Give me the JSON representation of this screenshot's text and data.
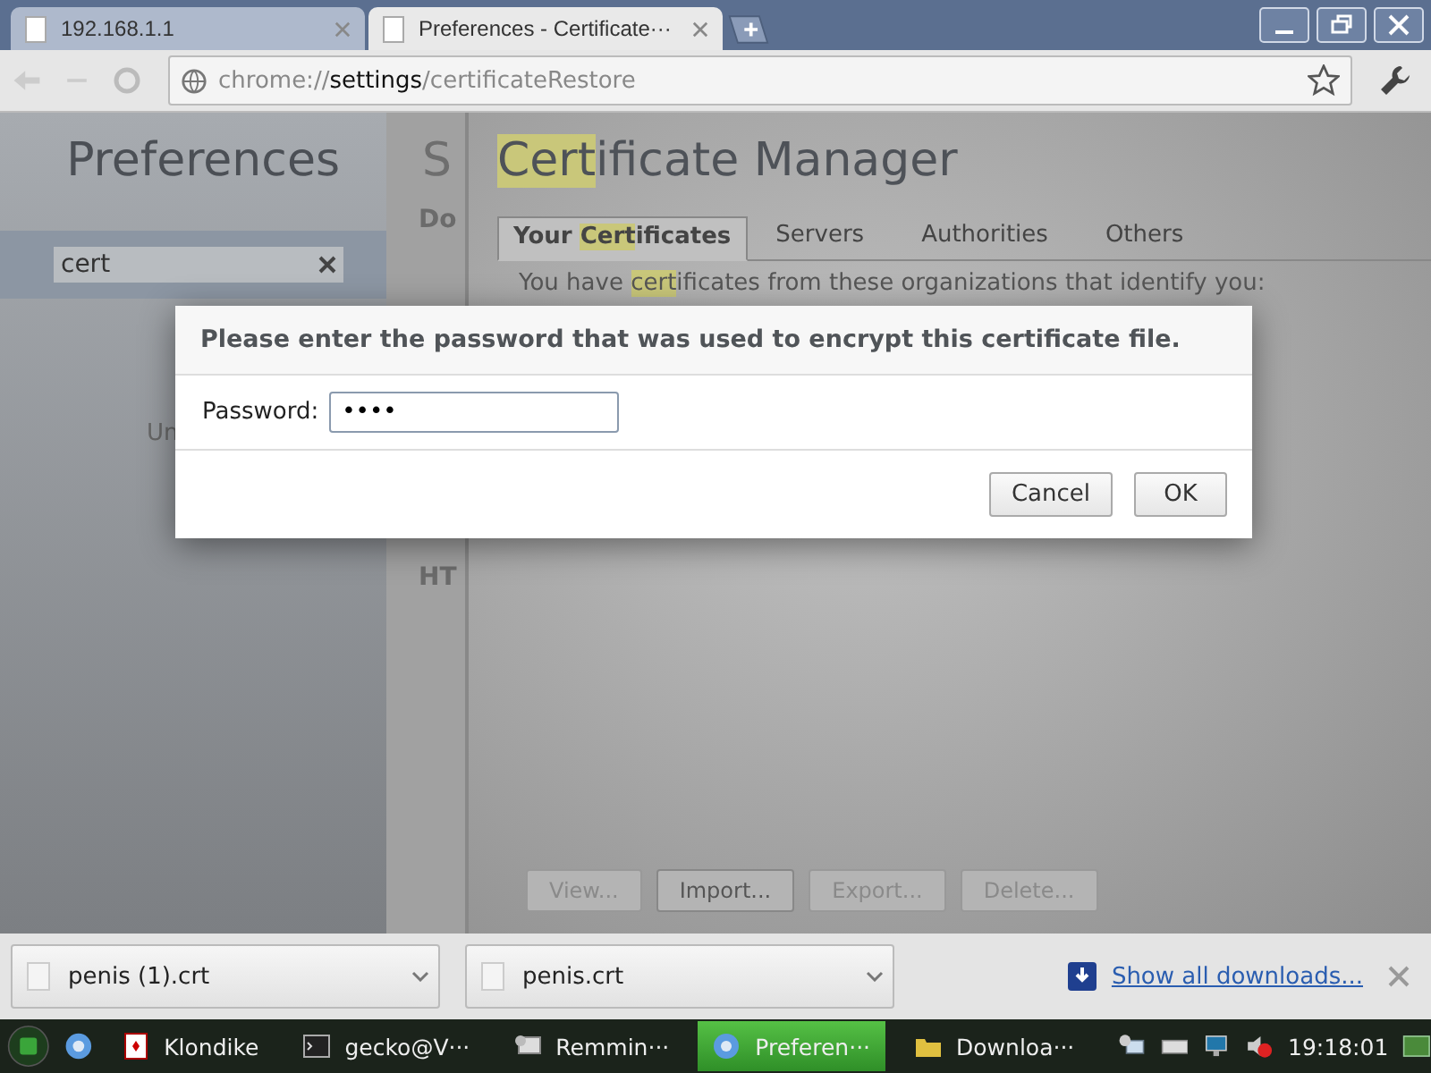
{
  "browser_tabs": [
    {
      "title": "192.168.1.1",
      "selected": false
    },
    {
      "title": "Preferences - Certificate···",
      "selected": true
    }
  ],
  "address_bar": {
    "scheme": "chrome://",
    "host": "settings",
    "path": "/certificateRestore"
  },
  "sidebar": {
    "title": "Preferences",
    "search": {
      "value": "cert"
    },
    "items": [
      "Un"
    ]
  },
  "middle_column": {
    "heading": "S",
    "items": [
      "Do",
      "HT"
    ]
  },
  "certificate_manager": {
    "title": [
      {
        "text": "Cert",
        "highlight": true
      },
      {
        "text": "ificate Manager",
        "highlight": false
      }
    ],
    "tabs": [
      {
        "label": [
          {
            "text": "Your ",
            "highlight": false
          },
          {
            "text": "Cert",
            "highlight": true
          },
          {
            "text": "ificates",
            "highlight": false
          }
        ],
        "selected": true
      },
      {
        "label": [
          {
            "text": "Servers",
            "highlight": false
          }
        ],
        "selected": false
      },
      {
        "label": [
          {
            "text": "Authorities",
            "highlight": false
          }
        ],
        "selected": false
      },
      {
        "label": [
          {
            "text": "Others",
            "highlight": false
          }
        ],
        "selected": false
      }
    ],
    "description": [
      {
        "text": "You have ",
        "highlight": false
      },
      {
        "text": "cert",
        "highlight": true
      },
      {
        "text": "ificates from these organizations that identify you:",
        "highlight": false
      }
    ],
    "buttons": [
      {
        "label": "View...",
        "disabled": true
      },
      {
        "label": "Import...",
        "disabled": false
      },
      {
        "label": "Export...",
        "disabled": true
      },
      {
        "label": "Delete...",
        "disabled": true
      }
    ]
  },
  "dialog": {
    "title": "Please enter the password that was used to encrypt this certificate file.",
    "password_label": "Password:",
    "password_value": "••••",
    "buttons": [
      "Cancel",
      "OK"
    ]
  },
  "downloads": {
    "items": [
      "penis (1).crt",
      "penis.crt"
    ],
    "show_all": "Show all downloads..."
  },
  "taskbar": {
    "items": [
      {
        "label": "Klondike",
        "active": false,
        "kind": "cards"
      },
      {
        "label": "gecko@V···",
        "active": false,
        "kind": "terminal"
      },
      {
        "label": "Remmin···",
        "active": false,
        "kind": "remote"
      },
      {
        "label": "Preferen···",
        "active": true,
        "kind": "browser"
      },
      {
        "label": "Downloa···",
        "active": false,
        "kind": "folder"
      }
    ],
    "clock": "19:18:01"
  }
}
